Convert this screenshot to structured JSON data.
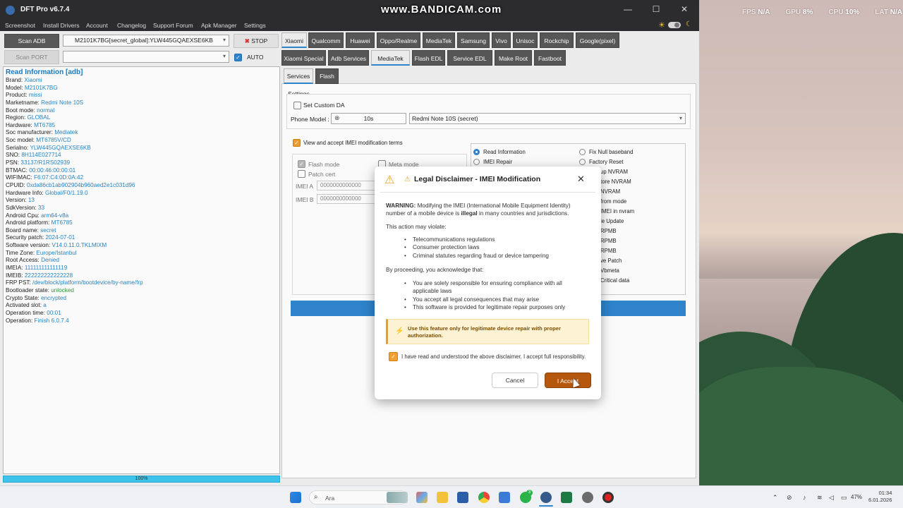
{
  "watermark": "www.BANDICAM.com",
  "overlay": {
    "fps_label": "FPS",
    "fps": "N/A",
    "gpu_label": "GPU",
    "gpu": "8%",
    "cpu_label": "CPU",
    "cpu": "10%",
    "lat_label": "LAT",
    "lat": "N/A"
  },
  "window": {
    "title": "DFT Pro v6.7.4",
    "minimize": "—",
    "maximize": "☐",
    "close": "✕"
  },
  "menu": [
    "Screenshot",
    "Install Drivers",
    "Account",
    "Changelog",
    "Support Forum",
    "Apk Manager",
    "Settings"
  ],
  "left_controls": {
    "scan_adb": "Scan ADB",
    "scan_port": "Scan PORT",
    "device_combo": "M2101K7BG[secret_global]:YLW445GQAEXSE6KB",
    "port_combo": "",
    "stop": "STOP",
    "auto": "AUTO"
  },
  "info": {
    "header": "Read Information [adb]",
    "rows": [
      {
        "k": "Brand:",
        "v": "Xiaomi"
      },
      {
        "k": "Model:",
        "v": "M2101K7BG"
      },
      {
        "k": "Product:",
        "v": "missi"
      },
      {
        "k": "Marketname:",
        "v": "Redmi Note 10S"
      },
      {
        "k": "Boot mode:",
        "v": "normal"
      },
      {
        "k": "Region:",
        "v": "GLOBAL"
      },
      {
        "k": "Hardware:",
        "v": "MT6785"
      },
      {
        "k": "Soc manufacturer:",
        "v": "Mediatek"
      },
      {
        "k": "Soc model:",
        "v": "MT6785V/CD"
      },
      {
        "k": "Serialno:",
        "v": "YLW445GQAEXSE6KB"
      },
      {
        "k": "SNO:",
        "v": "8H114E027714"
      },
      {
        "k": "PSN:",
        "v": "33137/R1RS02939"
      },
      {
        "k": "BTMAC:",
        "v": "00:00:46:00:00:01"
      },
      {
        "k": "WIFIMAC:",
        "v": "F6:07:C4:0D:0A:42"
      },
      {
        "k": "CPUID:",
        "v": "0xda86cb1ab902904b960aed2e1c031d96"
      },
      {
        "k": "Hardware Info:",
        "v": "Global/F0/1.19.0"
      },
      {
        "k": "Version:",
        "v": "13"
      },
      {
        "k": "SdkVersion:",
        "v": "33"
      },
      {
        "k": "Android Cpu:",
        "v": "arm64-v8a"
      },
      {
        "k": "Android platform:",
        "v": "MT6785"
      },
      {
        "k": "Board name:",
        "v": "secret"
      },
      {
        "k": "Security patch:",
        "v": "2024-07-01"
      },
      {
        "k": "Software version:",
        "v": "V14.0.11.0.TKLMIXM"
      },
      {
        "k": "Time Zone:",
        "v": "Europe/Istanbul"
      },
      {
        "k": "Root Access:",
        "v": "Denied"
      },
      {
        "k": "IMEIA:",
        "v": "111111111111119"
      },
      {
        "k": "IMEIB:",
        "v": "222222222222228"
      },
      {
        "k": "FRP PST:",
        "v": "/dev/block/platform/bootdevice/by-name/frp"
      },
      {
        "k": "Bootloader state:",
        "v": "unlocked"
      },
      {
        "k": "Crypto State:",
        "v": "encrypted"
      },
      {
        "k": "Activated slot:",
        "v": "a"
      },
      {
        "k": "Operation time:",
        "v": "00:01"
      },
      {
        "k": "Operation:",
        "v": "Finish 6.0.7.4"
      }
    ],
    "progress": "100%"
  },
  "brand_tabs": [
    "Xiaomi",
    "Qualcomm",
    "Huawei",
    "Oppo/Realme",
    "MediaTek",
    "Samsung",
    "Vivo",
    "Unisoc",
    "Rockchip",
    "Google(pixel)"
  ],
  "sub_tabs": [
    "Xiaomi Special",
    "Adb Services",
    "MediaTek",
    "Flash EDL",
    "Service EDL",
    "Make Root",
    "Fastboot"
  ],
  "service_tabs": [
    "Services",
    "Flash"
  ],
  "settings": {
    "title": "Settings",
    "custom_da": "Set Custom DA",
    "phone_model_label": "Phone Model :",
    "phone_search": "10s",
    "phone_model_value": "Redmi Note 10S (secret)"
  },
  "imei_section": {
    "accept_terms": "View and accept IMEI modification terms",
    "flash_mode": "Flash mode",
    "meta_mode": "Meta mode",
    "patch_cert": "Patch cert",
    "imei_a_label": "IMEI A",
    "imei_b_label": "IMEI B",
    "imei_a_value": "0000000000000",
    "imei_b_value": "0000000000000"
  },
  "right_options": {
    "col1": [
      "Read Information",
      "IMEI Repair"
    ],
    "col2": [
      "Fix Null baseband",
      "Factory Reset",
      "up NVRAM",
      "tore NVRAM",
      "NVRAM",
      "from mode",
      "IMEI in nvram",
      "le Update",
      "RPMB",
      "RPMB",
      "RPMB",
      "ve Patch",
      "Vbmeta",
      "Critical data"
    ]
  },
  "dialog": {
    "title": "Legal Disclaimer - IMEI Modification",
    "close": "✕",
    "warning_bold": "WARNING:",
    "warning_text_1": " Modifying the IMEI (International Mobile Equipment Identity)",
    "warning_text_2a": "number of a mobile device is ",
    "warning_illegal": "illegal",
    "warning_text_2b": " in many countries and jurisdictions.",
    "may_violate": "This action may violate:",
    "violations": [
      "Telecommunications regulations",
      "Consumer protection laws",
      "Criminal statutes regarding fraud or device tampering"
    ],
    "acknowledge": "By proceeding, you acknowledge that:",
    "acks": [
      "You are solely responsible for ensuring compliance with all",
      "applicable laws",
      "You accept all legal consequences that may arise",
      "This software is provided for legitimate repair purposes only"
    ],
    "note_1": "Use this feature only for legitimate device repair with proper",
    "note_2": "authorization.",
    "checkbox": "I have read and understood the above disclaimer. I accept full responsibility.",
    "cancel": "Cancel",
    "accept": "I Accept"
  },
  "taskbar": {
    "search": "Ara",
    "battery": "47%",
    "time": "01:34",
    "date": "6.01.2026",
    "badge": "3"
  },
  "colors": {
    "accent": "#2f86d0",
    "brand_blue": "#1c7cc0",
    "accept": "#b5570d",
    "warning": "#e8a020",
    "stop": "#e03030"
  }
}
